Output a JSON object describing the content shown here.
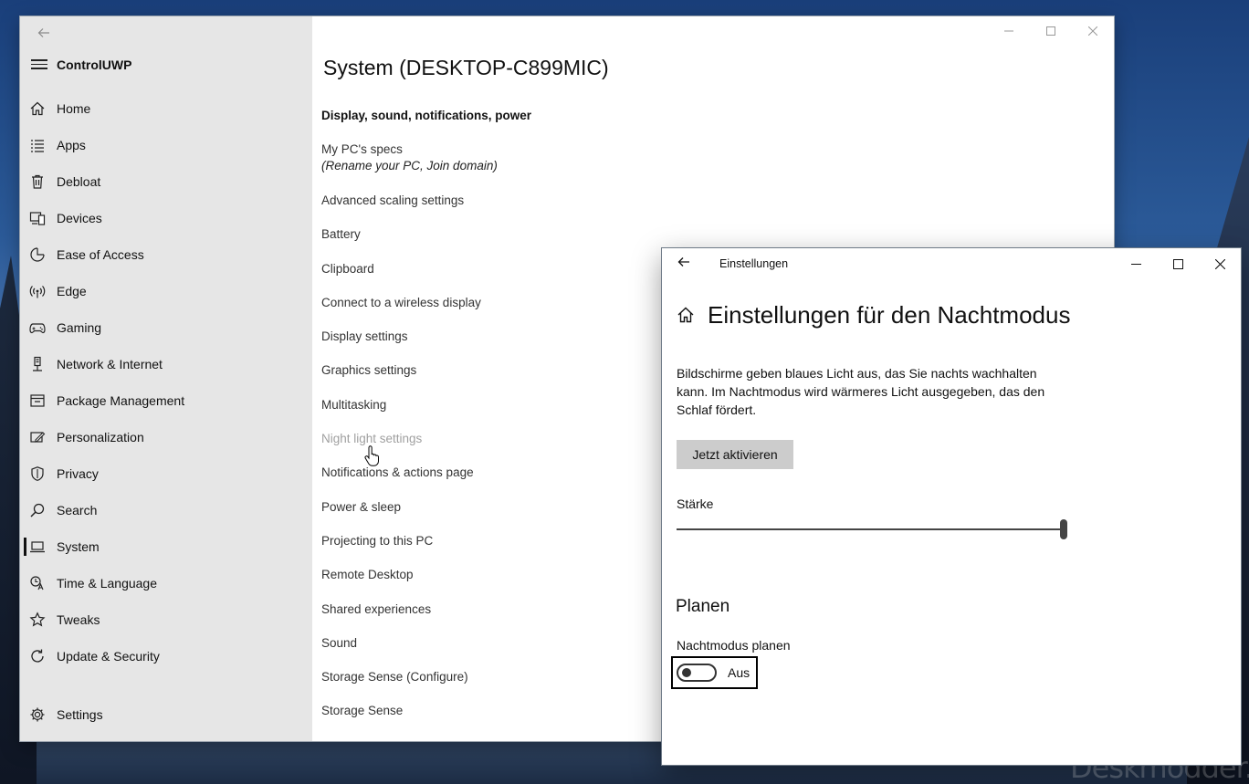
{
  "watermark": "Deskmodder.de",
  "main_window": {
    "app_title": "ControlUWP",
    "nav_items": [
      {
        "label": "Home",
        "icon": "home-icon"
      },
      {
        "label": "Apps",
        "icon": "apps-list-icon"
      },
      {
        "label": "Debloat",
        "icon": "trash-icon"
      },
      {
        "label": "Devices",
        "icon": "devices-icon"
      },
      {
        "label": "Ease of Access",
        "icon": "ease-of-access-icon"
      },
      {
        "label": "Edge",
        "icon": "broadcast-icon"
      },
      {
        "label": "Gaming",
        "icon": "gamepad-icon"
      },
      {
        "label": "Network & Internet",
        "icon": "network-icon"
      },
      {
        "label": "Package Management",
        "icon": "package-icon"
      },
      {
        "label": "Personalization",
        "icon": "personalization-icon"
      },
      {
        "label": "Privacy",
        "icon": "shield-icon"
      },
      {
        "label": "Search",
        "icon": "search-icon"
      },
      {
        "label": "System",
        "icon": "laptop-icon",
        "selected": true
      },
      {
        "label": "Time & Language",
        "icon": "time-language-icon"
      },
      {
        "label": "Tweaks",
        "icon": "star-icon"
      },
      {
        "label": "Update & Security",
        "icon": "update-icon"
      }
    ],
    "settings_label": "Settings",
    "page_title": "System (DESKTOP-C899MIC)",
    "section_heading": "Display, sound, notifications, power",
    "links": [
      {
        "label": "My PC's specs",
        "sub": "(Rename your PC, Join domain)"
      },
      {
        "label": "Advanced scaling settings"
      },
      {
        "label": "Battery"
      },
      {
        "label": "Clipboard"
      },
      {
        "label": "Connect to a wireless display"
      },
      {
        "label": "Display settings"
      },
      {
        "label": "Graphics settings"
      },
      {
        "label": "Multitasking"
      },
      {
        "label": "Night light settings",
        "hovered": true
      },
      {
        "label": "Notifications & actions page"
      },
      {
        "label": "Power & sleep"
      },
      {
        "label": "Projecting to this PC"
      },
      {
        "label": "Remote Desktop"
      },
      {
        "label": "Shared experiences"
      },
      {
        "label": "Sound"
      },
      {
        "label": "Storage Sense (Configure)"
      },
      {
        "label": "Storage Sense"
      }
    ]
  },
  "settings_window": {
    "title": "Einstellungen",
    "heading": "Einstellungen für den Nachtmodus",
    "description": "Bildschirme geben blaues Licht aus, das Sie nachts wachhalten kann. Im Nachtmodus wird wärmeres Licht ausgegeben, das den Schlaf fördert.",
    "activate_button": "Jetzt aktivieren",
    "strength_label": "Stärke",
    "strength_value": 1.0,
    "plan_heading": "Planen",
    "schedule_label": "Nachtmodus planen",
    "toggle_state": "Aus"
  }
}
